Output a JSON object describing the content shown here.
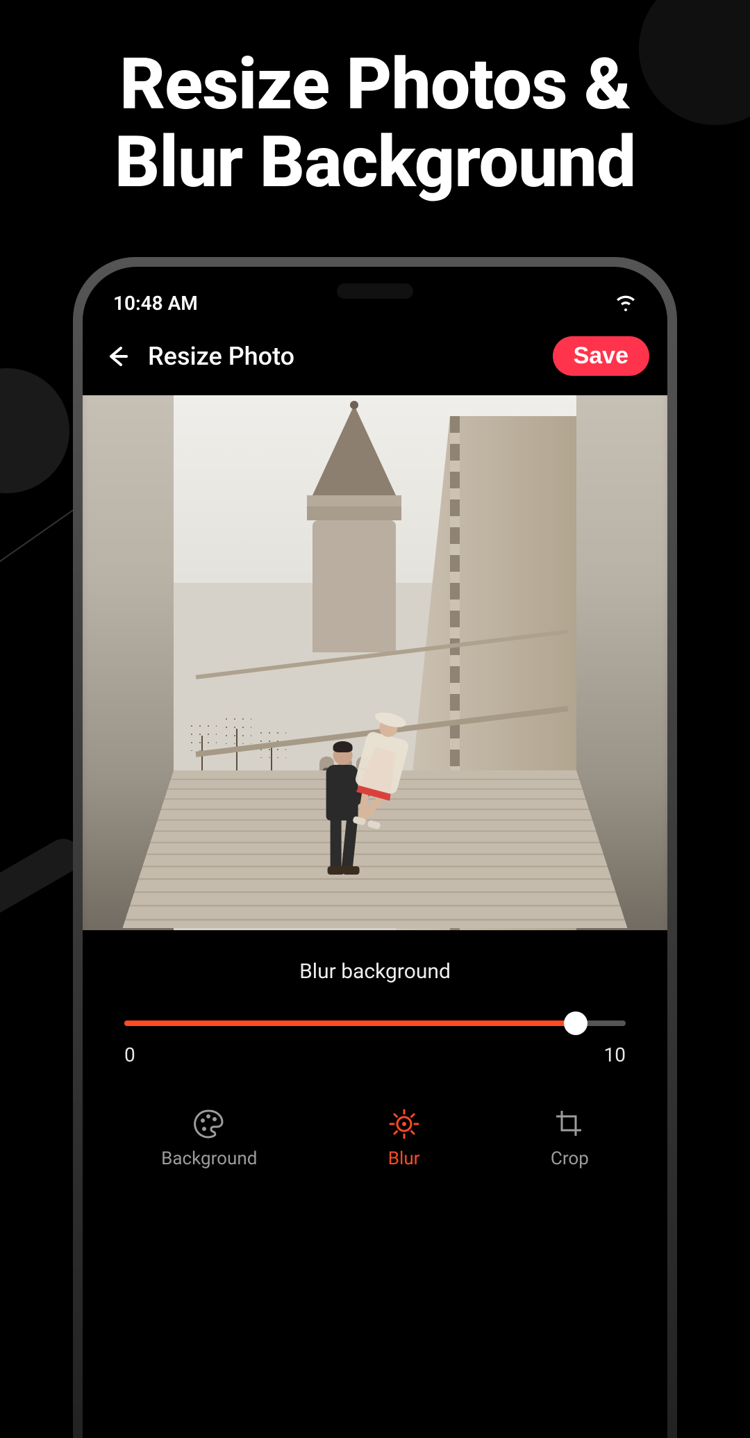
{
  "promo": {
    "headline_line1": "Resize Photos &",
    "headline_line2": "Blur Background"
  },
  "status_bar": {
    "time": "10:48 AM"
  },
  "header": {
    "title": "Resize Photo",
    "save_label": "Save"
  },
  "control": {
    "label": "Blur background",
    "min": "0",
    "max": "10",
    "value": 9,
    "range": 10
  },
  "tabs": [
    {
      "id": "background",
      "label": "Background",
      "active": false
    },
    {
      "id": "blur",
      "label": "Blur",
      "active": true
    },
    {
      "id": "crop",
      "label": "Crop",
      "active": false
    }
  ],
  "colors": {
    "accent": "#ff4a26",
    "save": "#ff344c"
  }
}
